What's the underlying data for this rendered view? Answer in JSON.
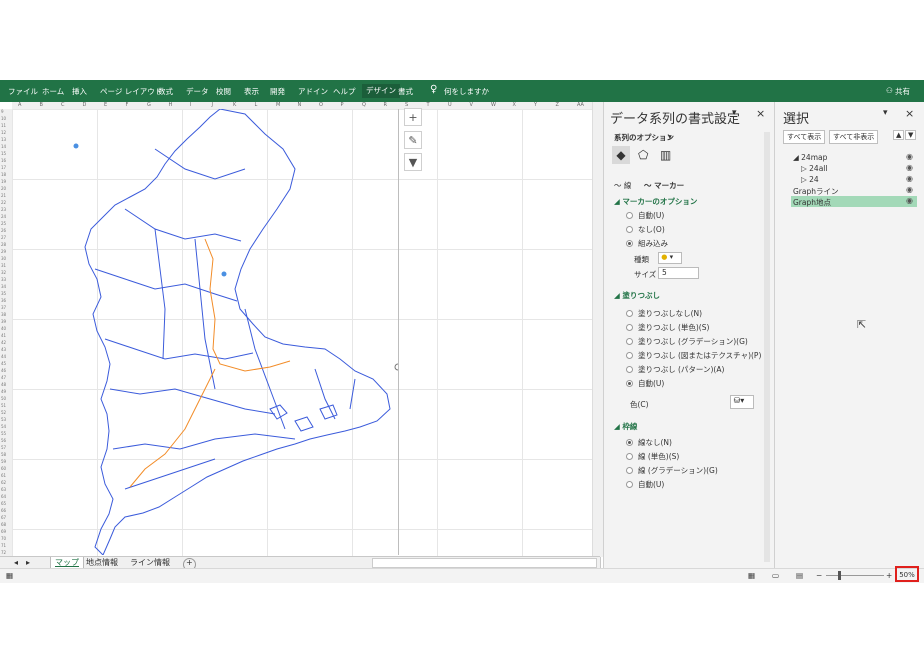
{
  "ribbon": {
    "tabs": [
      "ファイル",
      "ホーム",
      "挿入",
      "ページ レイアウト",
      "数式",
      "データ",
      "校閲",
      "表示",
      "開発",
      "アドイン",
      "ヘルプ",
      "デザイン",
      "書式"
    ],
    "active_tab": "デザイン",
    "search_label": "何をしますか",
    "share_label": "共有"
  },
  "sheet": {
    "col_labels": [
      "A",
      "B",
      "C",
      "D",
      "E",
      "F",
      "G",
      "H",
      "I",
      "J",
      "K",
      "L",
      "M",
      "N",
      "O",
      "P",
      "Q",
      "R",
      "S",
      "T",
      "U",
      "V",
      "W",
      "X",
      "Y",
      "Z",
      "AA"
    ],
    "row_start": 9
  },
  "sheet_tabs": {
    "items": [
      "マップ",
      "地点情報",
      "ライン情報"
    ],
    "active": "マップ",
    "add_label": "+"
  },
  "format_pane": {
    "title": "データ系列の書式設定",
    "series_options_label": "系列のオプション",
    "line_tab": "線",
    "marker_tab": "マーカー",
    "marker_options_section": "マーカーのオプション",
    "marker_options": [
      "自動(U)",
      "なし(O)",
      "組み込み"
    ],
    "marker_selected": "組み込み",
    "type_label": "種類",
    "size_label": "サイズ",
    "size_value": "5",
    "fill_section": "塗りつぶし",
    "fill_options": [
      "塗りつぶしなし(N)",
      "塗りつぶし (単色)(S)",
      "塗りつぶし (グラデーション)(G)",
      "塗りつぶし (図またはテクスチャ)(P)",
      "塗りつぶし (パターン)(A)",
      "自動(U)"
    ],
    "fill_selected": "自動(U)",
    "color_label": "色(C)",
    "border_section": "枠線",
    "border_options": [
      "線なし(N)",
      "線 (単色)(S)",
      "線 (グラデーション)(G)",
      "自動(U)"
    ],
    "border_selected": "線なし(N)"
  },
  "selection_pane": {
    "title": "選択",
    "show_all": "すべて表示",
    "hide_all": "すべて非表示",
    "items": [
      {
        "label": "24map",
        "indent": 0,
        "prefix": "◢"
      },
      {
        "label": "24all",
        "indent": 1,
        "prefix": "▷"
      },
      {
        "label": "24",
        "indent": 1,
        "prefix": "▷"
      },
      {
        "label": "Graphライン",
        "indent": 0,
        "prefix": ""
      },
      {
        "label": "Graph地点",
        "indent": 0,
        "prefix": "",
        "selected": true
      }
    ]
  },
  "status": {
    "zoom": "50%"
  },
  "colors": {
    "ribbon": "#217346",
    "map_boundary": "#3b5bdb",
    "route_line": "#f28c28",
    "selected_item": "#a3d9b8",
    "highlight_box": "#e0201c"
  }
}
